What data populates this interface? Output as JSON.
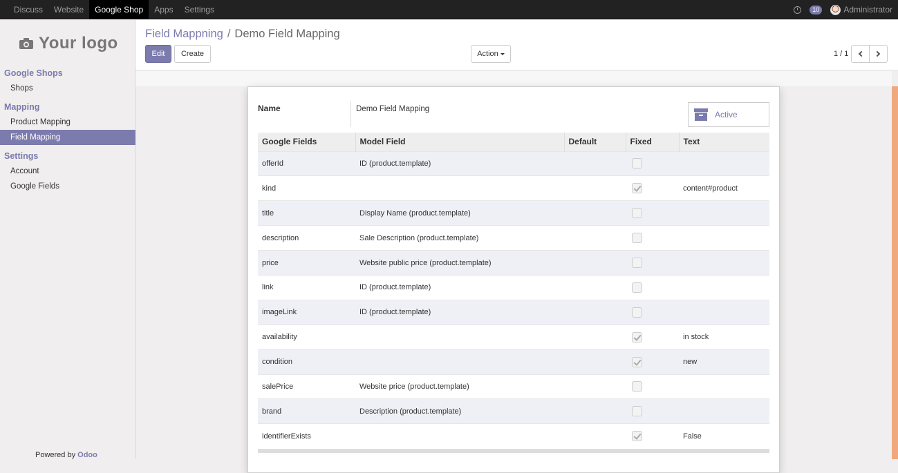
{
  "topbar": {
    "menu": [
      "Discuss",
      "Website",
      "Google Shop",
      "Apps",
      "Settings"
    ],
    "active_menu": "Google Shop",
    "messages_count": "10",
    "user_name": "Administrator"
  },
  "sidebar": {
    "logo_text": "Your logo",
    "sections": [
      {
        "title": "Google Shops",
        "items": [
          "Shops"
        ]
      },
      {
        "title": "Mapping",
        "items": [
          "Product Mapping",
          "Field Mapping"
        ]
      },
      {
        "title": "Settings",
        "items": [
          "Account",
          "Google Fields"
        ]
      }
    ],
    "active_item": "Field Mapping",
    "powered_by": "Powered by",
    "powered_brand": "Odoo"
  },
  "breadcrumb": {
    "parent": "Field Mappning",
    "separator": "/",
    "current": "Demo Field Mapping"
  },
  "buttons": {
    "edit": "Edit",
    "create": "Create",
    "action": "Action"
  },
  "pager": {
    "value": "1 / 1"
  },
  "form": {
    "name_label": "Name",
    "name_value": "Demo Field Mapping",
    "active_label": "Active"
  },
  "table": {
    "columns": [
      "Google Fields",
      "Model Field",
      "Default",
      "Fixed",
      "Text"
    ],
    "rows": [
      {
        "google_field": "offerId",
        "model_field": "ID (product.template)",
        "default": "",
        "fixed": false,
        "text": ""
      },
      {
        "google_field": "kind",
        "model_field": "",
        "default": "",
        "fixed": true,
        "text": "content#product"
      },
      {
        "google_field": "title",
        "model_field": "Display Name (product.template)",
        "default": "",
        "fixed": false,
        "text": ""
      },
      {
        "google_field": "description",
        "model_field": "Sale Description (product.template)",
        "default": "",
        "fixed": false,
        "text": ""
      },
      {
        "google_field": "price",
        "model_field": "Website public price (product.template)",
        "default": "",
        "fixed": false,
        "text": ""
      },
      {
        "google_field": "link",
        "model_field": "ID (product.template)",
        "default": "",
        "fixed": false,
        "text": ""
      },
      {
        "google_field": "imageLink",
        "model_field": "ID (product.template)",
        "default": "",
        "fixed": false,
        "text": ""
      },
      {
        "google_field": "availability",
        "model_field": "",
        "default": "",
        "fixed": true,
        "text": "in stock"
      },
      {
        "google_field": "condition",
        "model_field": "",
        "default": "",
        "fixed": true,
        "text": "new"
      },
      {
        "google_field": "salePrice",
        "model_field": "Website price (product.template)",
        "default": "",
        "fixed": false,
        "text": ""
      },
      {
        "google_field": "brand",
        "model_field": "Description (product.template)",
        "default": "",
        "fixed": false,
        "text": ""
      },
      {
        "google_field": "identifierExists",
        "model_field": "",
        "default": "",
        "fixed": true,
        "text": "False"
      }
    ]
  },
  "colors": {
    "brand": "#7c7bad",
    "topbar": "#222222",
    "accent_strip": "#f0a97e"
  }
}
